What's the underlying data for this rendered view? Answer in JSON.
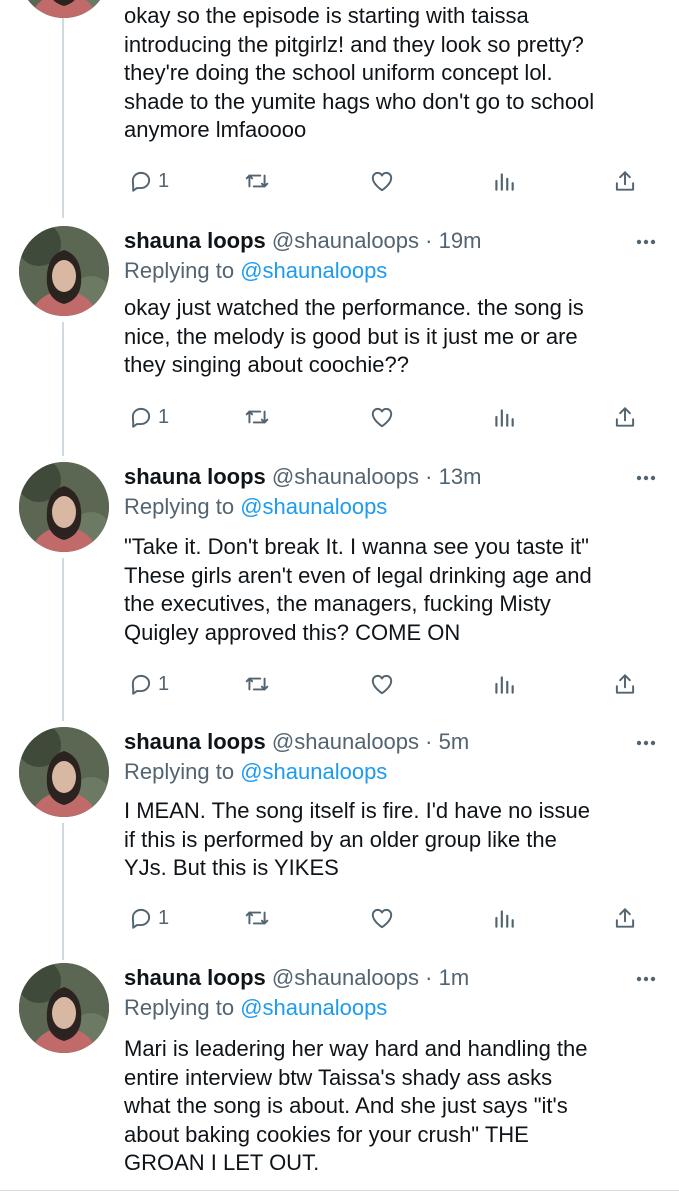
{
  "tweets": [
    {
      "body_lines": [
        "okay so the episode is starting with taissa",
        "introducing the pitgirlz! and they look so pretty?",
        "they're doing the school uniform concept lol.",
        "shade to the yumite hags who don't go to school",
        "anymore lmfaoooo"
      ],
      "reply_count": "1"
    },
    {
      "name": "shauna loops",
      "handle": "@shaunaloops",
      "time": "· 19m",
      "replying_prefix": "Replying to",
      "replying_to": "@shaunaloops",
      "body_lines": [
        "okay  just watched the performance. the song is",
        "nice, the melody is good but is it just me or are",
        "they singing about coochie??"
      ],
      "reply_count": "1"
    },
    {
      "name": "shauna loops",
      "handle": "@shaunaloops",
      "time": "· 13m",
      "replying_prefix": "Replying to",
      "replying_to": "@shaunaloops",
      "body_lines": [
        "\"Take it. Don't break It. I wanna see you taste it\"",
        "These girls aren't even of legal drinking age and",
        "the executives, the managers, fucking Misty",
        "Quigley approved this? COME ON"
      ],
      "reply_count": "1"
    },
    {
      "name": "shauna loops",
      "handle": "@shaunaloops",
      "time": "· 5m",
      "replying_prefix": "Replying to",
      "replying_to": "@shaunaloops",
      "body_lines": [
        "I MEAN. The song itself is fire. I'd have no issue",
        "if this is performed by an older group like the",
        "YJs. But this is YIKES"
      ],
      "reply_count": "1"
    },
    {
      "name": "shauna loops",
      "handle": "@shaunaloops",
      "time": "· 1m",
      "replying_prefix": "Replying to",
      "replying_to": "@shaunaloops",
      "body_lines": [
        "Mari is leadering her way hard and handling the",
        "entire interview btw  Taissa's shady ass asks",
        "what the song is about. And she just says \"it's",
        "about baking cookies for your crush\" THE",
        "GROAN I LET OUT."
      ]
    }
  ],
  "icons": {
    "reply": "reply-icon",
    "retweet": "retweet-icon",
    "like": "like-icon",
    "views": "views-icon",
    "share": "share-icon",
    "more": "more-icon"
  },
  "colors": {
    "link": "#1d9bf0",
    "secondary": "#536471",
    "primary_text": "#0f1419",
    "thread_line": "#cfd9de"
  }
}
